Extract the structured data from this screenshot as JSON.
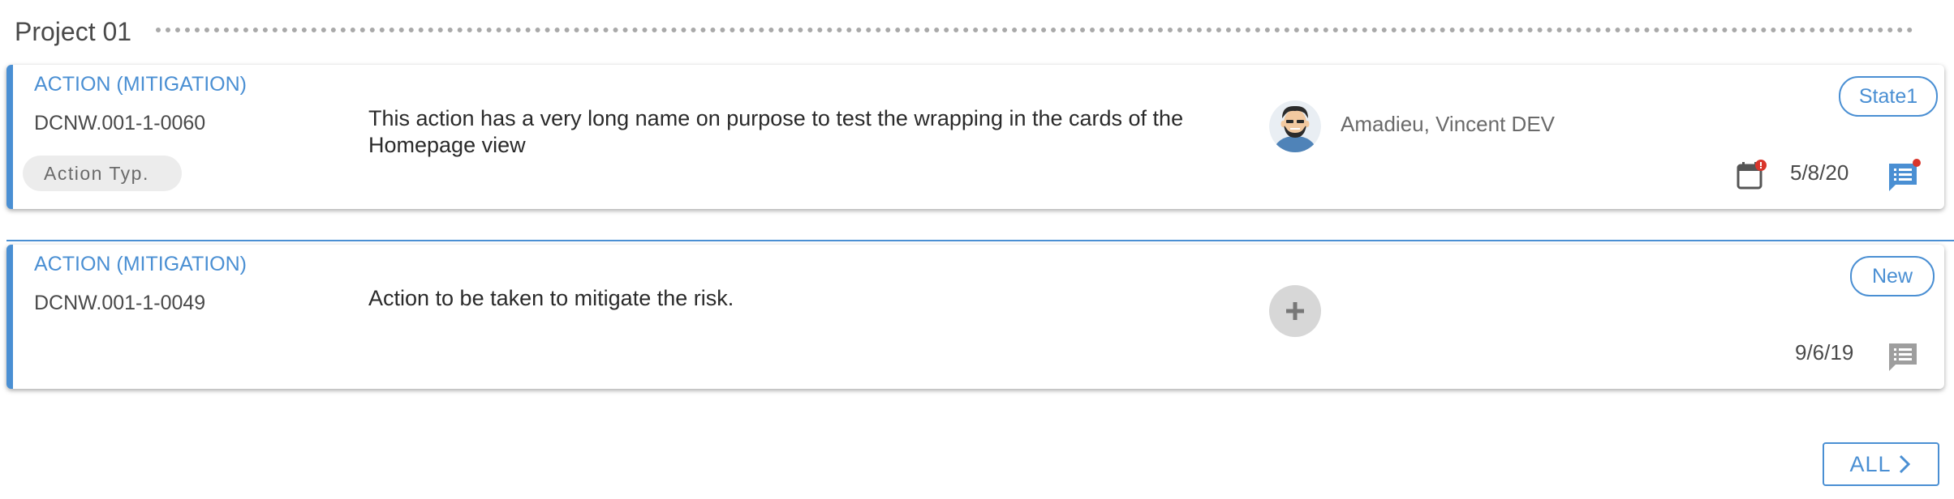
{
  "section": {
    "title": "Project 01"
  },
  "cards": [
    {
      "type_label": "ACTION (MITIGATION)",
      "id": "DCNW.001-1-0060",
      "action_type_badge": "Action Typ.",
      "description": "This action has a very long name on purpose to test the wrapping in the cards of the Homepage view",
      "owner": "Amadieu, Vincent DEV",
      "state": "State1",
      "due_date": "5/8/20",
      "has_due_alert": true,
      "has_comments": true
    },
    {
      "type_label": "ACTION (MITIGATION)",
      "id": "DCNW.001-1-0049",
      "description": "Action to be taken to mitigate the risk.",
      "owner": "",
      "state": "New",
      "due_date": "9/6/19",
      "has_comments": false
    }
  ],
  "footer": {
    "all_label": "ALL"
  },
  "icons": {
    "calendar": "calendar-icon",
    "comments": "comments-icon",
    "add": "plus-icon",
    "chevron": "chevron-right-icon"
  },
  "colors": {
    "accent": "#4a8fd3",
    "alert": "#d9352b",
    "muted_icon": "#9e9e9e"
  }
}
